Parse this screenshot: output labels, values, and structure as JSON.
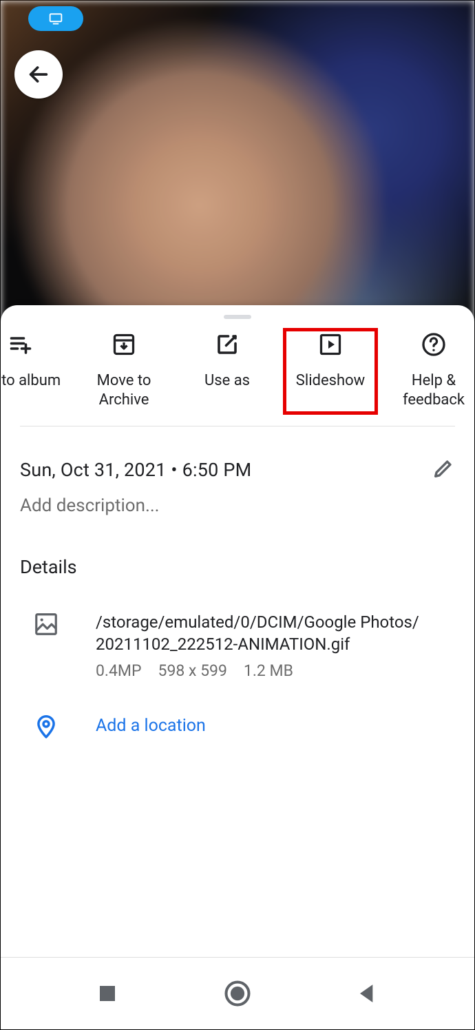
{
  "actions": {
    "add_album": "dd to album",
    "archive": "Move to Archive",
    "use_as": "Use as",
    "slideshow": "Slideshow",
    "help": "Help &\nfeedback"
  },
  "info": {
    "datetime": "Sun, Oct 31, 2021  •  6:50 PM",
    "description_placeholder": "Add description...",
    "details_header": "Details",
    "file_path_line1": "/storage/emulated/0/DCIM/Google Photos/",
    "file_path_line2": "20211102_222512-ANIMATION.gif",
    "megapixels": "0.4MP",
    "dimensions": "598 x 599",
    "filesize": "1.2 MB",
    "add_location": "Add a location"
  },
  "colors": {
    "accent": "#1a73e8",
    "highlight": "#e60000",
    "pill": "#1aa1f0"
  }
}
